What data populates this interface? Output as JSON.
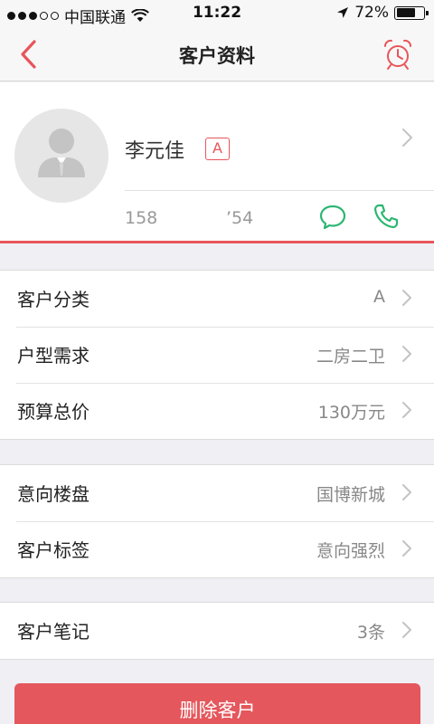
{
  "status_bar": {
    "carrier": "中国联通",
    "time": "11:22",
    "battery": "72%",
    "battery_level": 0.72
  },
  "nav": {
    "title": "客户资料",
    "back_icon": "chevron-left-icon",
    "alarm_icon": "alarm-clock-icon"
  },
  "profile": {
    "name": "李元佳",
    "grade": "A",
    "phone_prefix": "158",
    "phone_suffix": "’54",
    "accent_color": "#e8555a",
    "action_color": "#2bb673"
  },
  "groups": [
    {
      "rows": [
        {
          "label": "客户分类",
          "value": "A"
        },
        {
          "label": "户型需求",
          "value": "二房二卫"
        },
        {
          "label": "预算总价",
          "value": "130万元"
        }
      ]
    },
    {
      "rows": [
        {
          "label": "意向楼盘",
          "value": "国博新城"
        },
        {
          "label": "客户标签",
          "value": "意向强烈"
        }
      ]
    },
    {
      "rows": [
        {
          "label": "客户笔记",
          "value": "3条"
        }
      ]
    }
  ],
  "delete_button": "删除客户"
}
